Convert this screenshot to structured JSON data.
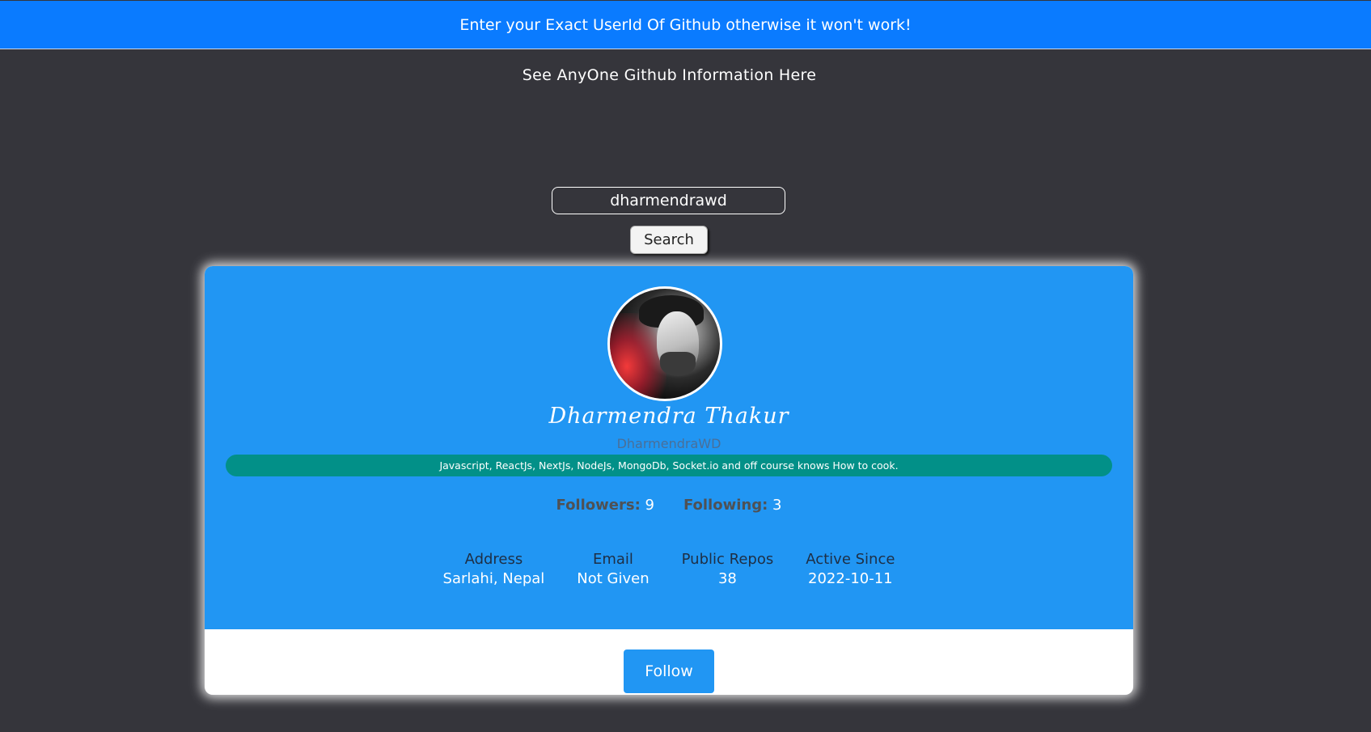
{
  "banner": {
    "text": "Enter your Exact UserId Of Github otherwise it won't work!"
  },
  "header": {
    "subtitle": "See AnyOne Github Information Here"
  },
  "search": {
    "value": "dharmendrawd",
    "button_label": "Search"
  },
  "profile": {
    "avatar_icon": "user-avatar-photo",
    "name": "Dharmendra Thakur",
    "username": "DharmendraWD",
    "bio": "Javascript, ReactJs, NextJs, NodeJs, MongoDb, Socket.io and off course knows How to cook.",
    "followers_label": "Followers:",
    "followers_value": "9",
    "following_label": "Following:",
    "following_value": "3",
    "info": [
      {
        "label": "Address",
        "value": "Sarlahi, Nepal"
      },
      {
        "label": "Email",
        "value": "Not Given"
      },
      {
        "label": "Public Repos",
        "value": "38"
      },
      {
        "label": "Active Since",
        "value": "2022-10-11"
      }
    ],
    "follow_label": "Follow"
  },
  "colors": {
    "background": "#35353b",
    "banner": "#0a7bff",
    "card_blue": "#2196f3",
    "bio_teal": "#029088"
  }
}
